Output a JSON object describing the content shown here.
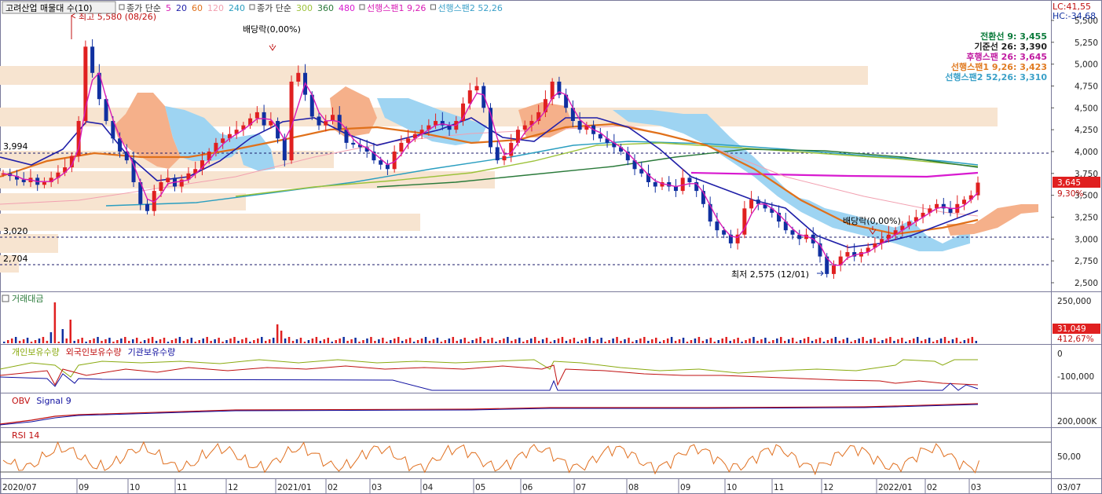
{
  "header": {
    "stock_selector": "고려산업 매물대 수(10)",
    "legend": [
      {
        "text": "종가 단순",
        "color": "#333333"
      },
      {
        "text": "5",
        "color": "#d81ab5"
      },
      {
        "text": "20",
        "color": "#1f1fa8"
      },
      {
        "text": "60",
        "color": "#e0701a"
      },
      {
        "text": "120",
        "color": "#f2a0b0"
      },
      {
        "text": "240",
        "color": "#2a9ec0"
      },
      {
        "text": "종가 단순",
        "color": "#333333"
      },
      {
        "text": "300",
        "color": "#9cc23a"
      },
      {
        "text": "360",
        "color": "#2a7a3a"
      },
      {
        "text": "480",
        "color": "#d81ad0"
      },
      {
        "text": "선행스팬1 9,26",
        "color": "#d81ab5"
      },
      {
        "text": "선행스팬2 52,26",
        "color": "#3aa0c8"
      }
    ],
    "lc": "LC:41,55",
    "hc": "HC:-34,68"
  },
  "indicators": [
    {
      "text": "전환선 9: 3,455",
      "color": "#0a7a3a"
    },
    {
      "text": "기준선 26: 3,390",
      "color": "#222222"
    },
    {
      "text": "후행스팬 26: 3,645",
      "color": "#c01aa0"
    },
    {
      "text": "선행스팬1 9,26: 3,423",
      "color": "#e07a20"
    },
    {
      "text": "선행스팬2 52,26: 3,310",
      "color": "#3aa0c8"
    }
  ],
  "annotations": {
    "high": "최고 5,580 (08/26)",
    "low": "최저 2,575 (12/01)",
    "dividend1": "배당락(0,00%)",
    "dividend2": "배당락(0,00%)",
    "left_3994": "3,994",
    "left_3020": "3,020",
    "left_2704": "2,704"
  },
  "price_axis": [
    "5,500",
    "5,250",
    "5,000",
    "4,750",
    "4,500",
    "4,250",
    "4,000",
    "3,750",
    "3,500",
    "3,250",
    "3,000",
    "2,750",
    "2,500"
  ],
  "price_tags": {
    "current": "3,645",
    "pct": "9,30%"
  },
  "volume_panel": {
    "title": "거래대금",
    "axis": [
      "250,000"
    ],
    "current": "31,049",
    "pct": "412,67%"
  },
  "holdings_panel": {
    "legend": [
      {
        "text": "개인보유수량",
        "color": "#8aaa10"
      },
      {
        "text": "외국인보유수량",
        "color": "#c01010"
      },
      {
        "text": "기관보유수량",
        "color": "#1010a0"
      }
    ],
    "axis": [
      "0",
      "-100,000"
    ]
  },
  "obv_panel": {
    "legend": [
      {
        "text": "OBV",
        "color": "#c01010"
      },
      {
        "text": "Signal 9",
        "color": "#1010a0"
      }
    ],
    "axis": [
      "200,000K"
    ]
  },
  "rsi_panel": {
    "legend": [
      {
        "text": "RSI 14",
        "color": "#c01010"
      }
    ],
    "axis": [
      "50,00"
    ]
  },
  "x_axis": [
    "2020/07",
    "09",
    "10",
    "11",
    "12",
    "2021/01",
    "02",
    "03",
    "04",
    "05",
    "06",
    "07",
    "08",
    "09",
    "10",
    "11",
    "12",
    "2022/01",
    "02",
    "03"
  ],
  "x_axis_right": "03/07",
  "colors": {
    "candle_up": "#e02020",
    "candle_down": "#1030a0",
    "cloud_up": "#f5b08a",
    "cloud_down": "#9ed4f2",
    "volume_profile": "#f7e4d0",
    "grid": "#1a1a6a"
  },
  "chart_data": {
    "type": "candlestick",
    "y_range": [
      2500,
      5580
    ],
    "dashed_levels": [
      3994,
      3020,
      2704
    ],
    "closes": [
      3750,
      3720,
      3680,
      3650,
      3700,
      3620,
      3650,
      3700,
      3760,
      3820,
      3950,
      4350,
      5200,
      4900,
      4600,
      4350,
      4150,
      4000,
      3900,
      3650,
      3400,
      3320,
      3550,
      3650,
      3700,
      3600,
      3680,
      3750,
      3800,
      3900,
      4000,
      4100,
      4150,
      4200,
      4250,
      4300,
      4380,
      4450,
      4300,
      4350,
      4150,
      3900,
      4800,
      4900,
      4650,
      4400,
      4300,
      4350,
      4420,
      4250,
      4100,
      4080,
      4050,
      4000,
      3900,
      3850,
      3800,
      4000,
      4100,
      4150,
      4200,
      4250,
      4300,
      4350,
      4300,
      4250,
      4350,
      4550,
      4700,
      4750,
      4500,
      4050,
      3900,
      3950,
      4100,
      4250,
      4300,
      4350,
      4450,
      4600,
      4800,
      4650,
      4500,
      4350,
      4250,
      4300,
      4200,
      4150,
      4100,
      4050,
      4000,
      3900,
      3800,
      3750,
      3650,
      3600,
      3650,
      3600,
      3550,
      3700,
      3650,
      3550,
      3400,
      3200,
      3100,
      3050,
      2950,
      3050,
      3350,
      3450,
      3400,
      3350,
      3300,
      3200,
      3100,
      3050,
      3000,
      3050,
      2950,
      2800,
      2600,
      2700,
      2800,
      2850,
      2800,
      2850,
      2900,
      2950,
      3000,
      3050,
      3100,
      3150,
      3200,
      3250,
      3300,
      3350,
      3400,
      3350,
      3300,
      3400,
      3450,
      3500,
      3645
    ]
  }
}
